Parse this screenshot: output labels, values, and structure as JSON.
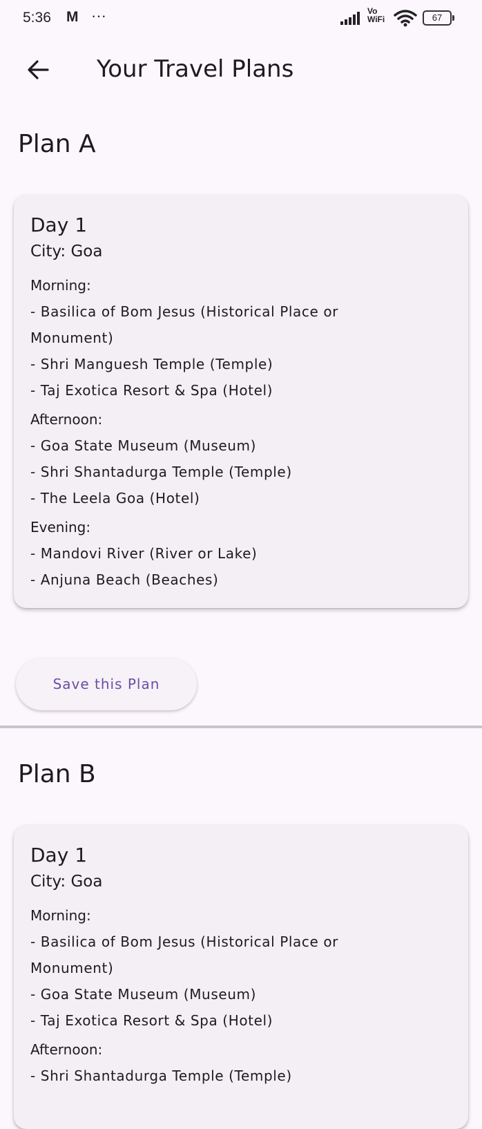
{
  "status_bar": {
    "time": "5:36",
    "carrier_icon": "M",
    "more": "···",
    "vowifi_top": "Vo",
    "vowifi_bottom": "WiFi",
    "battery": "67"
  },
  "app_bar": {
    "back_icon": "arrow-back-icon",
    "title": "Your Travel Plans"
  },
  "plans": [
    {
      "heading": "Plan A",
      "day": "Day 1",
      "city": "City: Goa",
      "morning_label": "Morning:",
      "morning": [
        "- Basilica of Bom Jesus (Historical Place or",
        "Monument)",
        "- Shri Manguesh Temple (Temple)",
        "- Taj Exotica Resort & Spa (Hotel)"
      ],
      "afternoon_label": "Afternoon:",
      "afternoon": [
        "- Goa State Museum (Museum)",
        "- Shri Shantadurga Temple (Temple)",
        "- The Leela Goa (Hotel)"
      ],
      "evening_label": "Evening:",
      "evening": [
        "- Mandovi River (River or Lake)",
        "- Anjuna Beach (Beaches)"
      ],
      "save_label": "Save this Plan"
    },
    {
      "heading": "Plan B",
      "day": "Day 1",
      "city": "City: Goa",
      "morning_label": "Morning:",
      "morning": [
        "- Basilica of Bom Jesus (Historical Place or",
        "Monument)",
        "- Goa State Museum (Museum)",
        "- Taj Exotica Resort & Spa (Hotel)"
      ],
      "afternoon_label": "Afternoon:",
      "afternoon": [
        "- Shri Shantadurga Temple (Temple)"
      ]
    }
  ],
  "colors": {
    "background": "#fcf7fd",
    "card": "#f4eff4",
    "accent": "#6750a4",
    "text": "#1d1b20"
  }
}
